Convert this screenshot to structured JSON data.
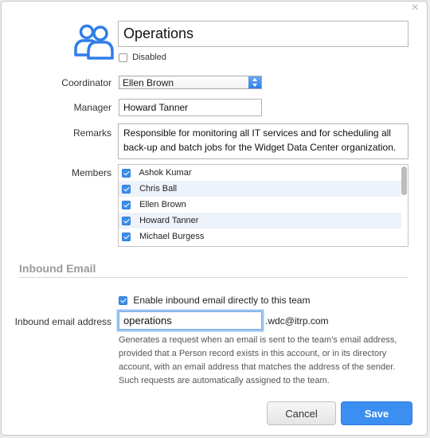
{
  "dialog": {
    "team_name": "Operations",
    "disabled_label": "Disabled",
    "disabled_checked": false
  },
  "fields": {
    "coordinator_label": "Coordinator",
    "coordinator_value": "Ellen Brown",
    "manager_label": "Manager",
    "manager_value": "Howard Tanner",
    "remarks_label": "Remarks",
    "remarks_value": "Responsible for monitoring all IT services and for scheduling all back-up and batch jobs for the Widget Data Center organization.",
    "members_label": "Members"
  },
  "members": [
    {
      "name": "Ashok Kumar",
      "checked": true
    },
    {
      "name": "Chris Ball",
      "checked": true
    },
    {
      "name": "Ellen Brown",
      "checked": true
    },
    {
      "name": "Howard Tanner",
      "checked": true
    },
    {
      "name": "Michael Burgess",
      "checked": true
    }
  ],
  "inbound_email": {
    "section_title": "Inbound Email",
    "enable_label": "Enable inbound email directly to this team",
    "enable_checked": true,
    "address_label": "Inbound email address",
    "address_value": "operations",
    "domain_suffix": ".wdc@itrp.com",
    "help_text": "Generates a request when an email is sent to the team's email address, provided that a Person record exists in this account, or in its directory account, with an email address that matches the address of the sender. Such requests are automatically assigned to the team."
  },
  "buttons": {
    "cancel_label": "Cancel",
    "save_label": "Save"
  },
  "icons": {
    "team": "team-icon",
    "close": "close-icon"
  },
  "colors": {
    "accent": "#3b8ff0",
    "icon_blue": "#2f7ee8"
  }
}
